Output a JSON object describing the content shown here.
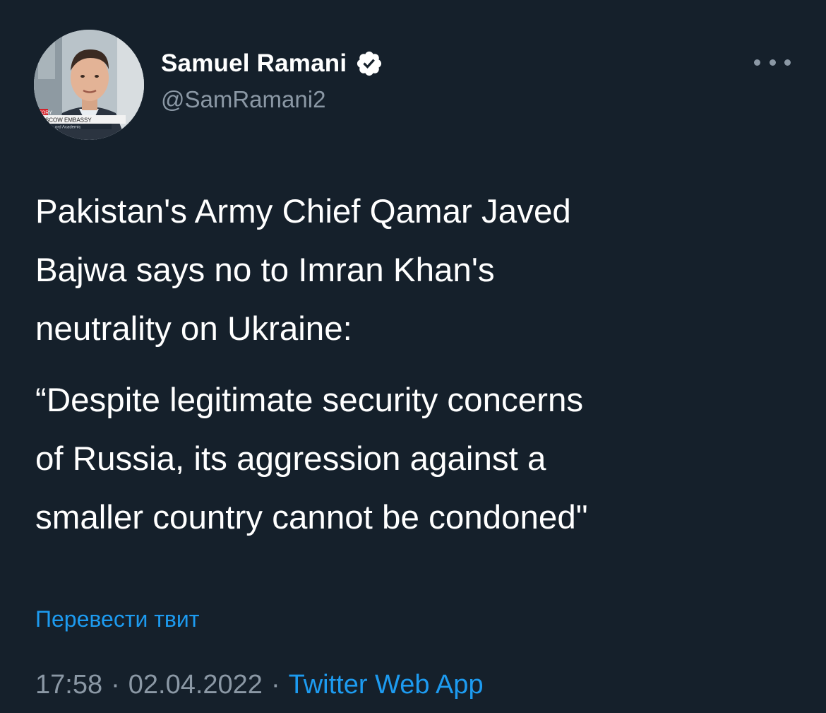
{
  "author": {
    "display_name": "Samuel Ramani",
    "handle": "@SamRamani2",
    "verified": true,
    "avatar_caption_lines": [
      "STORY",
      "MOSCOW EMBASSY",
      "ord Academic"
    ]
  },
  "tweet": {
    "paragraphs": [
      "Pakistan's Army Chief Qamar Javed\nBajwa says no to Imran Khan's\nneutrality on Ukraine:",
      "“Despite legitimate security concerns\nof Russia, its aggression against a\nsmaller country cannot be condoned\""
    ],
    "translate_label": "Перевести твит",
    "time": "17:58",
    "date": "02.04.2022",
    "separator": "·",
    "source": "Twitter Web App"
  },
  "icons": {
    "verified": "verified-badge-icon",
    "more": "more-options-icon"
  },
  "colors": {
    "background": "#15202b",
    "text": "#ffffff",
    "secondary": "#8b98a5",
    "accent": "#1d9bf0"
  }
}
